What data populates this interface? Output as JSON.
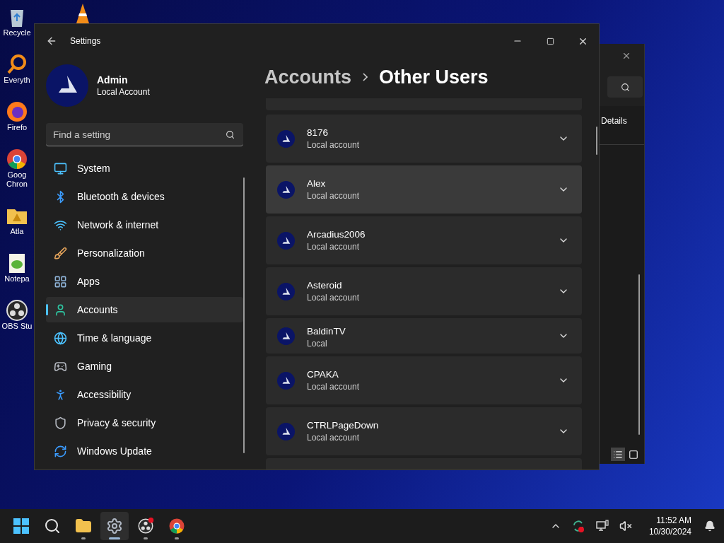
{
  "desktop_icons": [
    {
      "kind": "recycle",
      "lines": [
        "Recycle"
      ]
    },
    {
      "kind": "search-app",
      "lines": [
        "Everyth"
      ]
    },
    {
      "kind": "firefox",
      "lines": [
        "Firefo"
      ]
    },
    {
      "kind": "chrome",
      "lines": [
        "Goog",
        "Chron"
      ]
    },
    {
      "kind": "folder",
      "lines": [
        "Atla"
      ]
    },
    {
      "kind": "notepad",
      "lines": [
        "Notepa"
      ]
    },
    {
      "kind": "obs",
      "lines": [
        "OBS Stu"
      ]
    }
  ],
  "background_window": {
    "label": "Details"
  },
  "window": {
    "title": "Settings"
  },
  "profile": {
    "name": "Admin",
    "account_type": "Local Account"
  },
  "search": {
    "placeholder": "Find a setting"
  },
  "nav": [
    {
      "kind": "system",
      "label": "System",
      "selected": false
    },
    {
      "kind": "bluetooth",
      "label": "Bluetooth & devices",
      "selected": false
    },
    {
      "kind": "network",
      "label": "Network & internet",
      "selected": false
    },
    {
      "kind": "personalization",
      "label": "Personalization",
      "selected": false
    },
    {
      "kind": "apps",
      "label": "Apps",
      "selected": false
    },
    {
      "kind": "accounts",
      "label": "Accounts",
      "selected": true
    },
    {
      "kind": "time",
      "label": "Time & language",
      "selected": false
    },
    {
      "kind": "gaming",
      "label": "Gaming",
      "selected": false
    },
    {
      "kind": "accessibility",
      "label": "Accessibility",
      "selected": false
    },
    {
      "kind": "privacy",
      "label": "Privacy & security",
      "selected": false
    },
    {
      "kind": "update",
      "label": "Windows Update",
      "selected": false
    }
  ],
  "breadcrumb": [
    "Accounts",
    "Other Users"
  ],
  "users": [
    {
      "kind": "full",
      "name": "8176",
      "type": "Local account",
      "hovered": false
    },
    {
      "kind": "full",
      "name": "Alex",
      "type": "Local account",
      "hovered": true
    },
    {
      "kind": "full",
      "name": "Arcadius2006",
      "type": "Local account",
      "hovered": false
    },
    {
      "kind": "full",
      "name": "Asteroid",
      "type": "Local account",
      "hovered": false
    },
    {
      "kind": "clipped",
      "name": "BaldinTV",
      "type": "Local",
      "hovered": false
    },
    {
      "kind": "full",
      "name": "CPAKA",
      "type": "Local account",
      "hovered": false
    },
    {
      "kind": "full",
      "name": "CTRLPageDown",
      "type": "Local account",
      "hovered": false
    }
  ],
  "taskbar": {
    "apps": [
      {
        "kind": "start",
        "running": false,
        "active": false
      },
      {
        "kind": "search",
        "running": false,
        "active": false
      },
      {
        "kind": "files",
        "running": true,
        "active": false
      },
      {
        "kind": "settings",
        "running": true,
        "active": true
      },
      {
        "kind": "obs",
        "running": true,
        "active": false
      },
      {
        "kind": "chrome",
        "running": true,
        "active": false
      }
    ],
    "time": "11:52 AM",
    "date": "10/30/2024"
  }
}
